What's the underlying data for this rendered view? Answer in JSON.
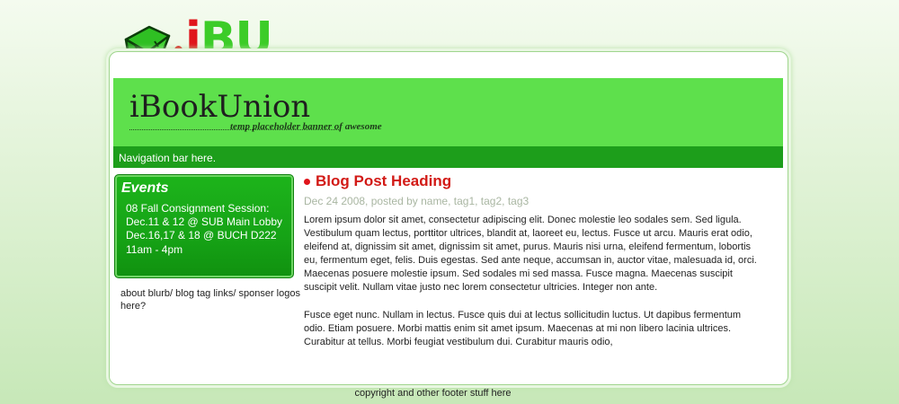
{
  "logo": {
    "letter_i": "i",
    "letters_bu": "BU",
    "icon": "book-icon"
  },
  "banner": {
    "site_name": "iBookUnion",
    "tagline": "temp placeholder banner of awesome"
  },
  "navbar": {
    "text": "Navigation bar here."
  },
  "events": {
    "title": "Events",
    "lines": [
      "08 Fall Consignment Session:",
      "Dec.11 & 12 @ SUB Main Lobby",
      "Dec.16,17 & 18 @ BUCH D222",
      "11am - 4pm"
    ]
  },
  "sidebar": {
    "about_text": "about blurb/ blog tag links/ sponser logos here?"
  },
  "post": {
    "heading": "Blog Post Heading",
    "meta": "Dec 24 2008, posted by name, tag1, tag2, tag3",
    "paragraphs": [
      "Lorem ipsum dolor sit amet, consectetur adipiscing elit. Donec molestie leo sodales sem. Sed ligula. Vestibulum quam lectus, porttitor ultrices, blandit at, laoreet eu, lectus. Fusce ut arcu. Mauris erat odio, eleifend at, dignissim sit amet, dignissim sit amet, purus. Mauris nisi urna, eleifend fermentum, lobortis eu, fermentum eget, felis. Duis egestas. Sed ante neque, accumsan in, auctor vitae, malesuada id, orci. Maecenas posuere molestie ipsum. Sed sodales mi sed massa. Fusce magna. Maecenas suscipit suscipit velit. Nullam vitae justo nec lorem consectetur ultricies. Integer non ante.",
      "Fusce eget nunc. Nullam in lectus. Fusce quis dui at lectus sollicitudin luctus. Ut dapibus fermentum odio. Etiam posuere. Morbi mattis enim sit amet ipsum. Maecenas at mi non libero lacinia ultrices. Curabitur at tellus. Morbi feugiat vestibulum dui. Curabitur mauris odio,"
    ]
  },
  "footer": {
    "text": "copyright and other footer stuff here"
  },
  "colors": {
    "banner_green": "#5ee04c",
    "nav_green": "#1d9e1b",
    "accent_red": "#d21a16"
  }
}
